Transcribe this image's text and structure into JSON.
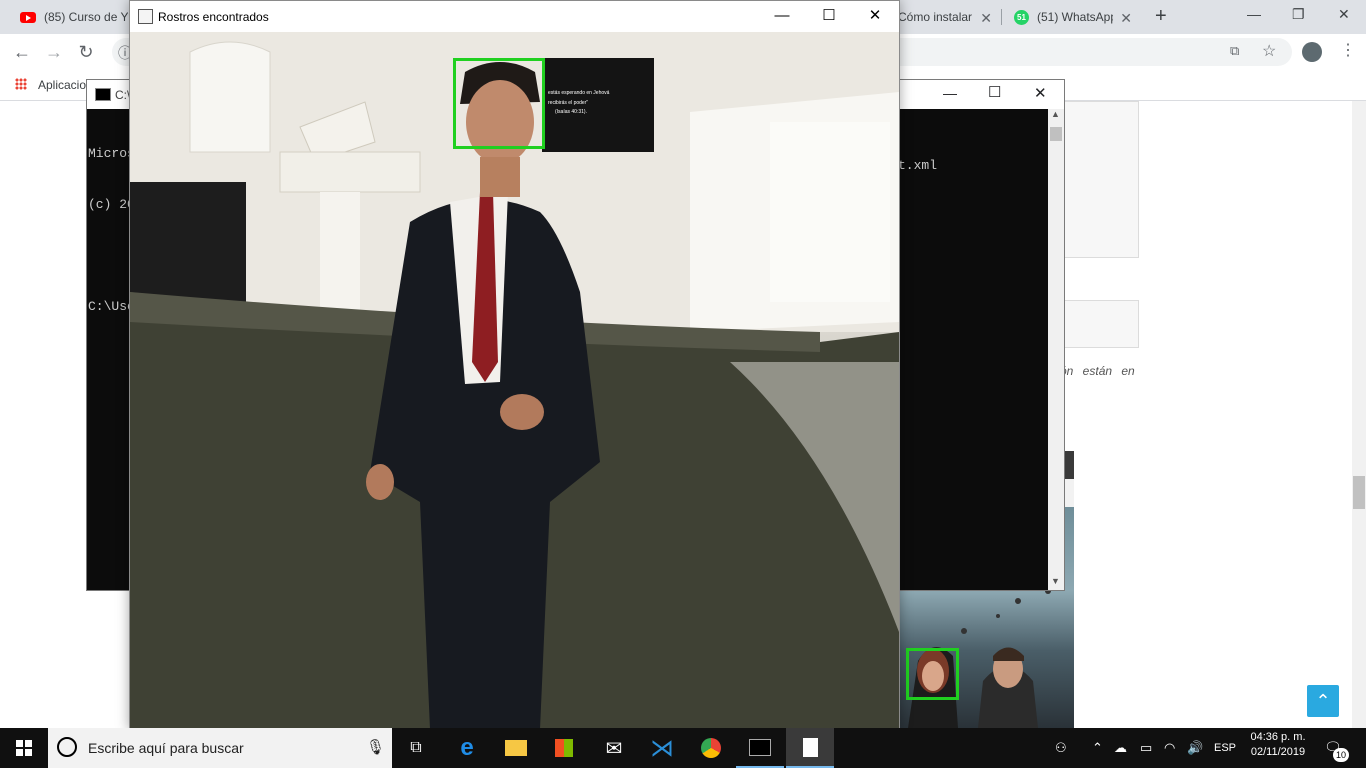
{
  "chrome": {
    "tabs": [
      {
        "title": "(85) Curso de Y",
        "icon": "youtube-icon"
      },
      {
        "title": "Cómo instalar",
        "icon": "page-icon"
      },
      {
        "title": "(51) WhatsApp",
        "icon": "whatsapp-icon",
        "badge": "51"
      }
    ],
    "new_tab": "+",
    "bookmarks": {
      "apps_label": "Aplicacio"
    },
    "page_text": "ón  están  en"
  },
  "cmd": {
    "title": "C:\\",
    "lines": [
      "Micros",
      "(c) 20",
      "",
      "C:\\Use"
    ],
    "line_tail": "t.xml"
  },
  "face_window": {
    "title": "Rostros encontrados",
    "tv_text": [
      "estás esperando en Jehová",
      "recibirás el poder\"",
      "(Isaías 40:31)."
    ]
  },
  "taskbar": {
    "search_placeholder": "Escribe aquí para buscar",
    "lang": "ESP",
    "time": "04:36 p. m.",
    "date": "02/11/2019",
    "notifications": "10"
  }
}
